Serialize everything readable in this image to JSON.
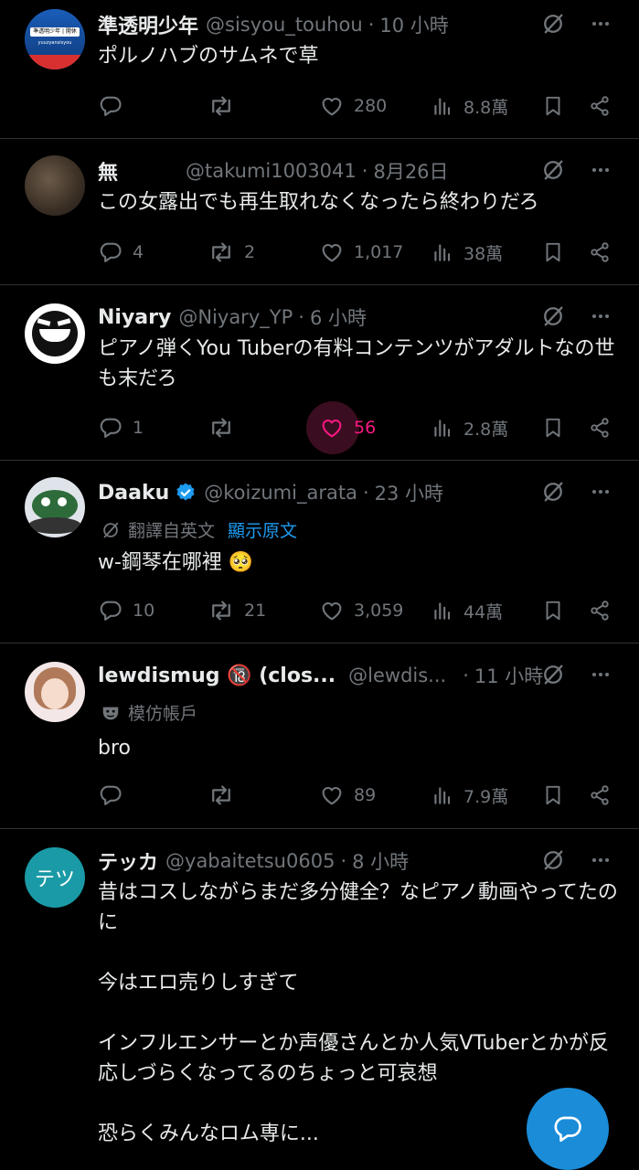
{
  "tweets": [
    {
      "name": "準透明少年",
      "handle": "@sisyou_touhou",
      "time": "10 小時",
      "text": "ポルノハブのサムネで草",
      "reply": "",
      "retweet": "",
      "like": "280",
      "views": "8.8萬",
      "avatar_text": "準透明少年 | 開休",
      "avatar_sub": "yuuzyansisyou"
    },
    {
      "name": "無",
      "handle": "@takumi1003041",
      "time": "8月26日",
      "text": "この女露出でも再生取れなくなったら終わりだろ",
      "reply": "4",
      "retweet": "2",
      "like": "1,017",
      "views": "38萬"
    },
    {
      "name": "Niyary",
      "handle": "@Niyary_YP",
      "time": "6 小時",
      "text": "ピアノ弾くYou Tuberの有料コンテンツがアダルトなの世も末だろ",
      "reply": "1",
      "retweet": "",
      "like": "56",
      "views": "2.8萬"
    },
    {
      "name": "Daaku",
      "handle": "@koizumi_arata",
      "time": "23 小時",
      "translated_label": "翻譯自英文",
      "show_original": "顯示原文",
      "text": "w-鋼琴在哪裡 🥺",
      "reply": "10",
      "retweet": "21",
      "like": "3,059",
      "views": "44萬"
    },
    {
      "name": "lewdismug 🔞 (clos...",
      "handle": "@lewdis...",
      "time": "11 小時",
      "parody_label": "模仿帳戶",
      "text": "bro",
      "reply": "",
      "retweet": "",
      "like": "89",
      "views": "7.9萬"
    },
    {
      "name": "テッカ",
      "handle": "@yabaitetsu0605",
      "time": "8 小時",
      "avatar_text": "テツ",
      "text": "昔はコスしながらまだ多分健全？なピアノ動画やってたのに\n\n今はエロ売りしすぎて\n\nインフルエンサーとか声優さんとか人気VTuberとかが反応しづらくなってるのちょっと可哀想\n\n恐らくみんなロム専に..."
    }
  ],
  "colors": {
    "background": "#000000",
    "text": "#e7e9ea",
    "secondary": "#71767b",
    "like_active": "#f91880",
    "link": "#1d9bf0",
    "fab": "#1a8cd8",
    "verified": "#1d9bf0"
  },
  "icons": {
    "reply": "reply-icon",
    "retweet": "retweet-icon",
    "like": "heart-icon",
    "views": "views-icon",
    "bookmark": "bookmark-icon",
    "share": "share-icon",
    "grok": "grok-icon",
    "more": "more-icon",
    "compose": "compose-reply-icon"
  }
}
